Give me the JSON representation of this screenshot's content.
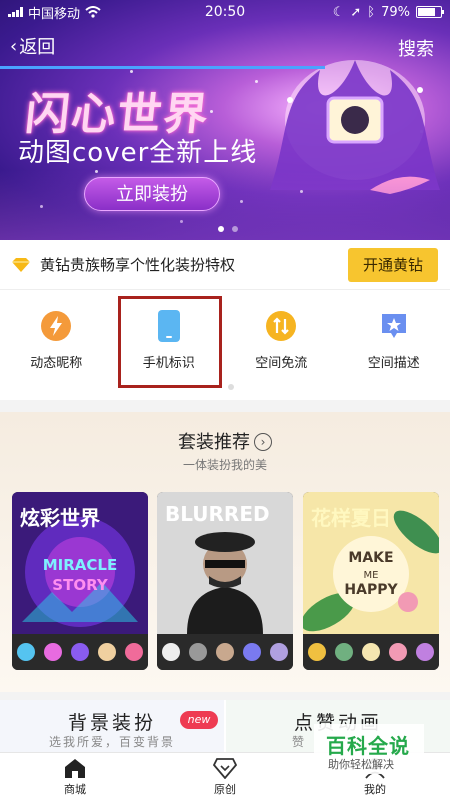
{
  "status_bar": {
    "carrier": "中国移动",
    "time": "20:50",
    "battery": "79%",
    "battery_level": 0.79
  },
  "nav": {
    "back_label": "返回",
    "search_label": "搜索"
  },
  "banner": {
    "title": "闪心世界",
    "subtitle": "动图cover全新上线",
    "button": "立即装扮",
    "page_count": 2,
    "active_page": 1
  },
  "vip": {
    "text": "黄钻贵族畅享个性化装扮特权",
    "button": "开通黄钻"
  },
  "features": [
    {
      "label": "动态昵称",
      "icon": "lightning-icon",
      "color": "#f49a3a"
    },
    {
      "label": "手机标识",
      "icon": "phone-icon",
      "color": "#5bb6f2"
    },
    {
      "label": "空间免流",
      "icon": "data-free-icon",
      "color": "#f6b421"
    },
    {
      "label": "空间描述",
      "icon": "star-badge-icon",
      "color": "#6a8ff0"
    }
  ],
  "suits": {
    "title": "套装推荐",
    "subtitle": "一体装扮我的美",
    "cards": [
      {
        "title": "炫彩世界",
        "art_text": "MIRACLE STORY"
      },
      {
        "title": "BLURRED",
        "art_text": ""
      },
      {
        "title": "花样夏日",
        "art_text": "MAKE ME HAPPY"
      }
    ]
  },
  "promos": [
    {
      "title": "背景装扮",
      "subtitle": "选我所爱，百变背景",
      "badge": "new"
    },
    {
      "title": "点赞动画",
      "subtitle": "赞"
    }
  ],
  "tabbar": [
    {
      "label": "商城",
      "icon": "store-icon"
    },
    {
      "label": "原创",
      "icon": "diamond-icon"
    },
    {
      "label": "我的",
      "icon": "profile-icon"
    }
  ],
  "watermark": {
    "brand": "百科全说",
    "slogan": "助你轻松解决"
  },
  "colors": {
    "accent_yellow": "#f7c52f",
    "banner_purple": "#6a2fb8",
    "highlight_red": "#a8221d",
    "badge_red": "#ee3b52"
  }
}
